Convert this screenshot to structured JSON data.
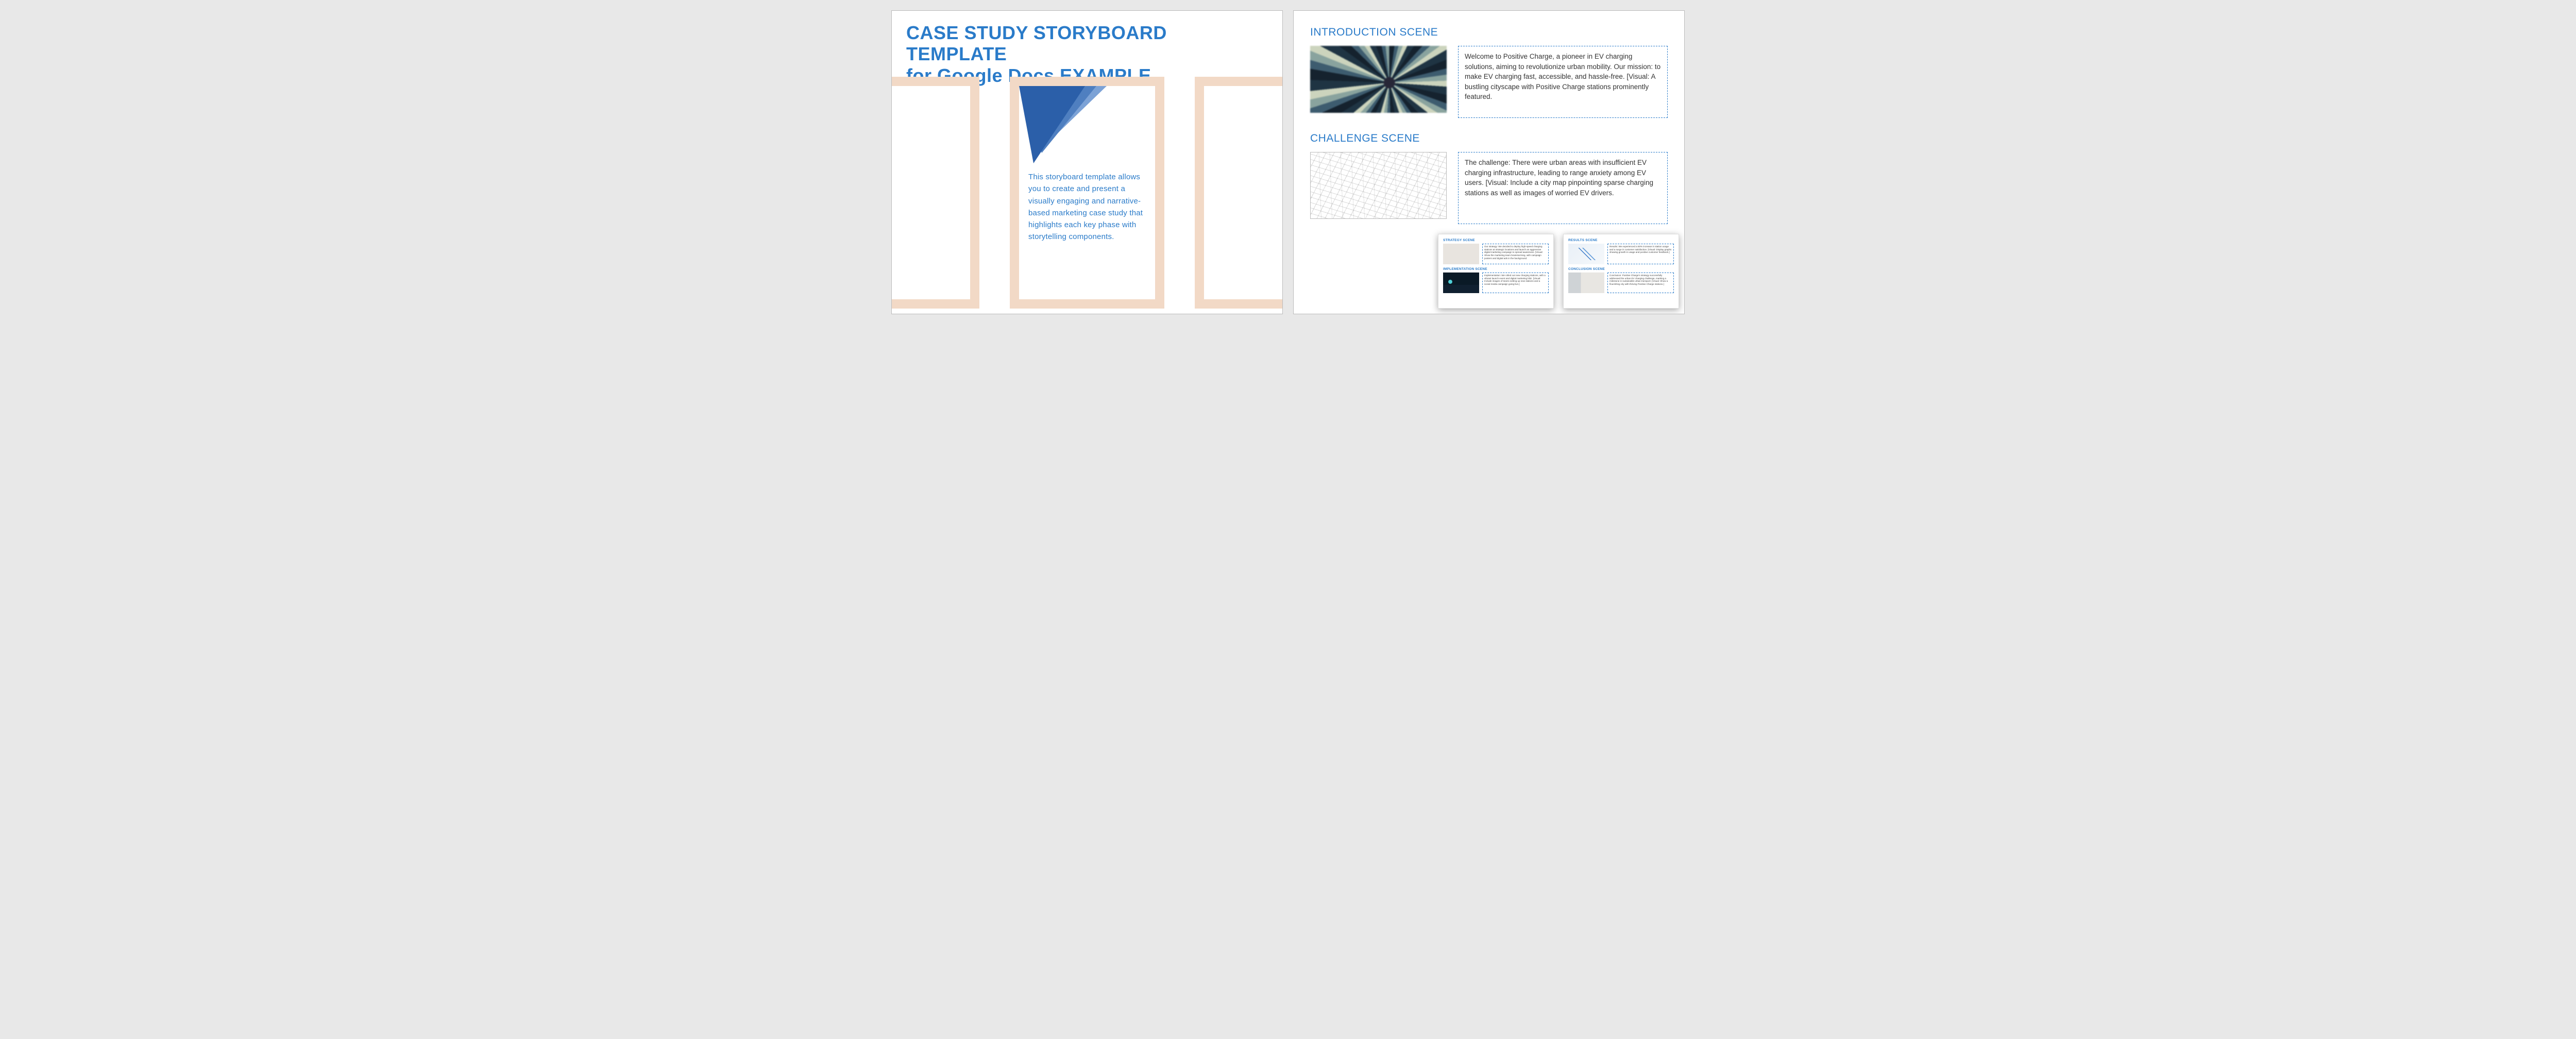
{
  "page1": {
    "title_line1": "CASE STUDY STORYBOARD TEMPLATE",
    "title_line2": "for Google Docs EXAMPLE",
    "intro_text": "This storyboard template allows you to create and present a visually engaging and narrative-based marketing case study that highlights each key phase with storytelling components."
  },
  "page2": {
    "scenes": [
      {
        "title": "INTRODUCTION SCENE",
        "desc": "Welcome to Positive Charge, a pioneer in EV charging solutions, aiming to revolutionize urban mobility. Our mission: to make EV charging fast, accessible, and hassle-free. [Visual: A bustling cityscape with Positive Charge stations prominently featured."
      },
      {
        "title": "CHALLENGE SCENE",
        "desc": "The challenge: There were urban areas with insufficient EV charging infrastructure, leading to range anxiety among EV users. [Visual: Include a city map pinpointing sparse charging stations as well as images of worried EV drivers."
      }
    ]
  },
  "thumbs": {
    "left": {
      "scene1": {
        "title": "STRATEGY SCENE",
        "desc": "Our strategy: We decided to deploy high-speed charging stations at strategic locations and launch an aggressive digital marketing campaign to spread awareness. [Visual: Show the marketing team brainstorming, with campaign posters and digital ads in the background."
      },
      "scene2": {
        "title": "IMPLEMENTATION SCENE",
        "desc": "Implementation: We rolled out new charging stations, with a vibrant launch event and digital marketing blitz. [Visual: Include images of teams setting up new stations and a social media campaign going live.]"
      }
    },
    "right": {
      "scene1": {
        "title": "RESULTS SCENE",
        "desc": "Results: We experienced a 50% increase in station usage and a surge in customer satisfaction. [Visual: Display graphs showing growth in usage and positive customer feedback.]"
      },
      "scene2": {
        "title": "CONCLUSION SCENE",
        "desc": "Conclusion: Positive Charge's strategy successfully addressed the urban EV charging challenge, marking a milestone in sustainable urban transport. [Visual: Show a flourishing city with thriving Positive Charge stations.]"
      }
    }
  }
}
